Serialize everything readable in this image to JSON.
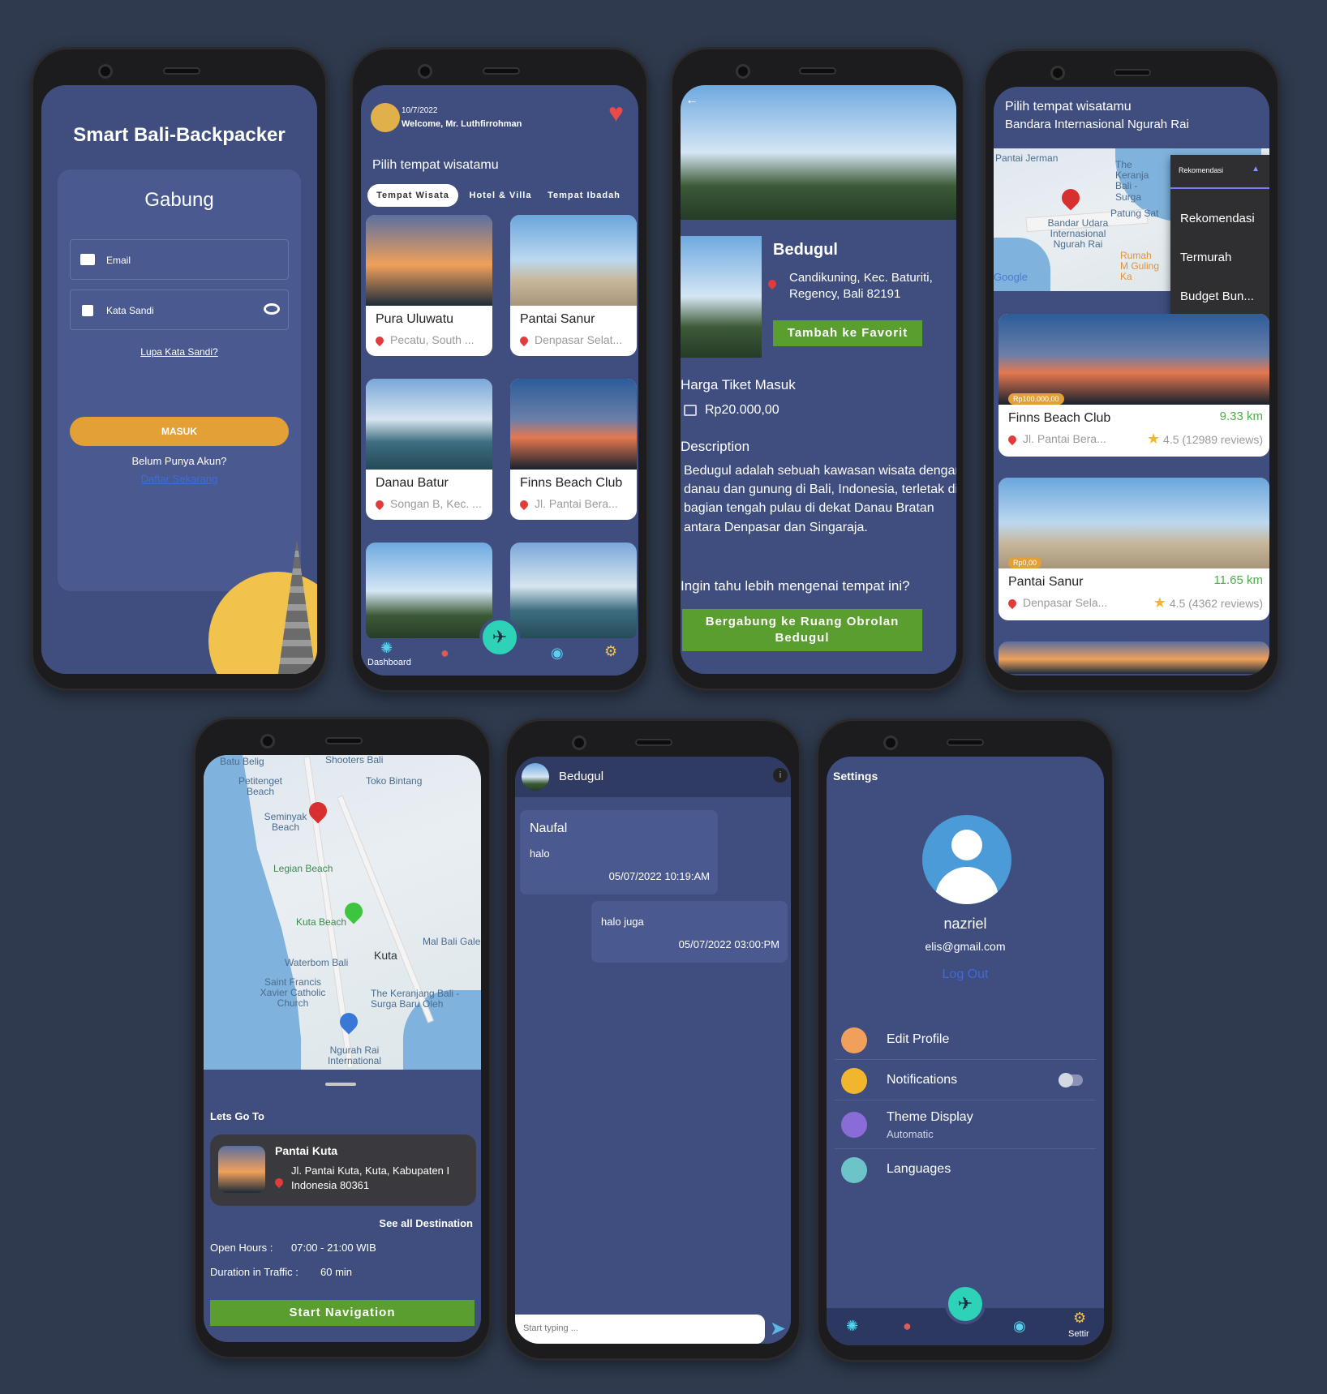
{
  "login": {
    "title": "Smart Bali-Backpacker",
    "heading": "Gabung",
    "email_placeholder": "Email",
    "password_placeholder": "Kata Sandi",
    "forgot": "Lupa Kata Sandi?",
    "submit": "MASUK",
    "no_account": "Belum Punya Akun?",
    "register": "Daftar Sekarang"
  },
  "dashboard": {
    "date": "10/7/2022",
    "welcome": "Welcome, Mr. Luthfirrohman",
    "section_title": "Pilih tempat wisatamu",
    "tabs": [
      "Tempat Wisata",
      "Hotel & Villa",
      "Tempat Ibadah"
    ],
    "cards": [
      {
        "name": "Pura Uluwatu",
        "location": "Pecatu, South ..."
      },
      {
        "name": "Pantai Sanur",
        "location": "Denpasar Selat..."
      },
      {
        "name": "Danau Batur",
        "location": "Songan B, Kec. ..."
      },
      {
        "name": "Finns Beach Club",
        "location": "Jl. Pantai Bera..."
      }
    ],
    "nav_label": "Dashboard"
  },
  "detail": {
    "name": "Bedugul",
    "address": "Candikuning, Kec. Baturiti, Regency, Bali 82191",
    "fav_button": "Tambah ke Favorit",
    "ticket_title": "Harga Tiket Masuk",
    "ticket_price": "Rp20.000,00",
    "desc_title": "Description",
    "description": "Bedugul adalah sebuah kawasan wisata dengan danau dan gunung di Bali, Indonesia, terletak di bagian tengah pulau di dekat Danau Bratan antara Denpasar dan Singaraja.",
    "more_title": "Ingin tahu lebih mengenai tempat ini?",
    "chat_button": "Bergabung ke Ruang Obrolan Bedugul"
  },
  "listing": {
    "title": "Pilih tempat wisatamu",
    "subtitle": "Bandara Internasional Ngurah Rai",
    "dropdown_selected": "Rekomendasi",
    "dropdown_options": [
      "Rekomendasi",
      "Termurah",
      "Budget Bun..."
    ],
    "map_labels": [
      "Pantai Jerman",
      "The Keranja Bali - Surga",
      "Patung Sat",
      "Bandar Udara Internasional Ngurah Rai",
      "Rumah M Guling Ka",
      "Google"
    ],
    "items": [
      {
        "name": "Finns Beach Club",
        "price": "Rp100.000,00",
        "distance": "9.33 km",
        "location": "Jl. Pantai Bera...",
        "rating": "4.5 (12989 reviews)"
      },
      {
        "name": "Pantai Sanur",
        "price": "Rp0,00",
        "distance": "11.65 km",
        "location": "Denpasar Sela...",
        "rating": "4.5 (4362 reviews)"
      }
    ]
  },
  "navigation": {
    "map_labels": [
      "Batu Belig",
      "Shooters Bali",
      "Petitenget Beach",
      "Toko Bintang",
      "Seminyak Beach",
      "Legian Beach",
      "Kuta Beach",
      "Mal Bali Gale",
      "Waterbom Bali",
      "Kuta",
      "Saint Francis Xavier Catholic Church",
      "The Keranjang Bali - Surga Baru Oleh",
      "Ngurah Rai International"
    ],
    "heading": "Lets Go To",
    "place": "Pantai Kuta",
    "address": "Jl. Pantai Kuta, Kuta, Kabupaten I Indonesia 80361",
    "see_all": "See all Destination",
    "open_hours_label": "Open Hours :",
    "open_hours": "07:00 - 21:00 WIB",
    "duration_label": "Duration in Traffic :",
    "duration": "60 min",
    "start": "Start Navigation"
  },
  "chat": {
    "room": "Bedugul",
    "messages": [
      {
        "sender": "Naufal",
        "text": "halo",
        "time": "05/07/2022 10:19:AM"
      },
      {
        "sender": "",
        "text": "halo juga",
        "time": "05/07/2022 03:00:PM"
      }
    ],
    "input_placeholder": "Start typing ..."
  },
  "settings": {
    "title": "Settings",
    "username": "nazriel",
    "email": "elis@gmail.com",
    "logout": "Log Out",
    "rows": [
      {
        "label": "Edit Profile",
        "sub": ""
      },
      {
        "label": "Notifications",
        "sub": ""
      },
      {
        "label": "Theme Display",
        "sub": "Automatic"
      },
      {
        "label": "Languages",
        "sub": ""
      }
    ],
    "nav_label": "Settir"
  },
  "colors": {
    "bg": "#2f3a4e",
    "screen": "#3f4e7e",
    "accent_orange": "#e3a037",
    "accent_green": "#5a9e2f",
    "fab": "#2ed3b7"
  }
}
